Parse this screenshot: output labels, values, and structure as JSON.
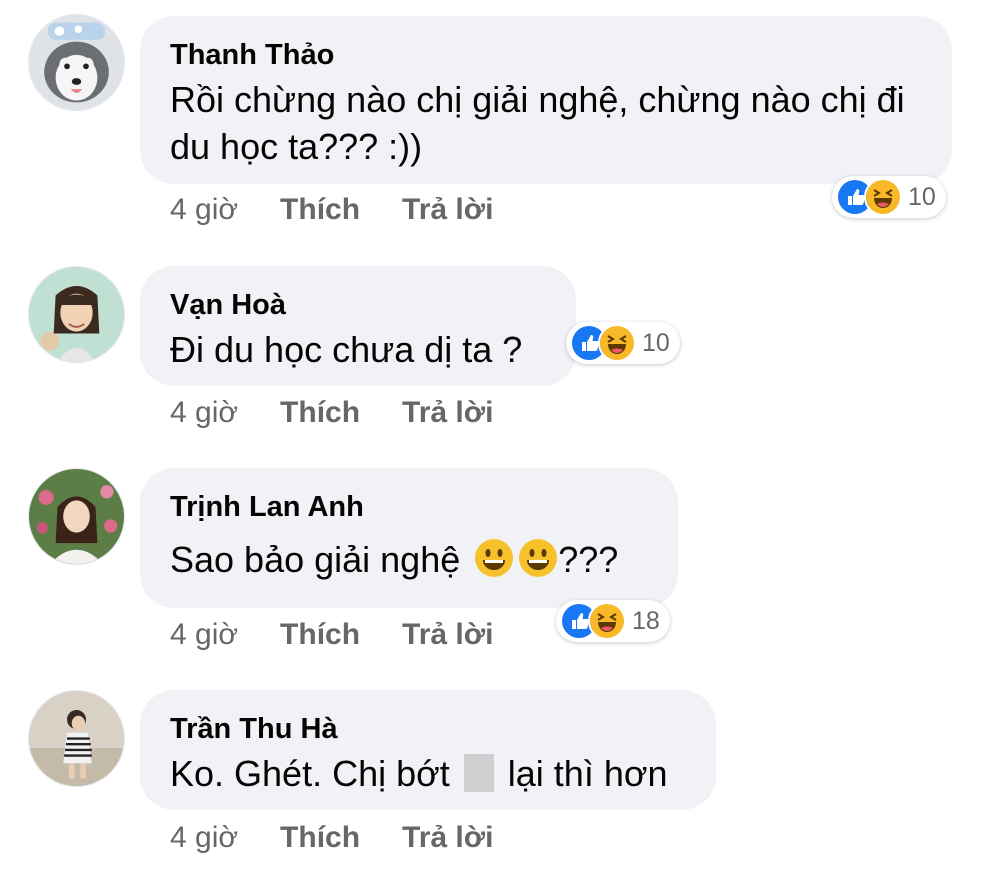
{
  "comments": [
    {
      "author": "Thanh Thảo",
      "text": "Rồi chừng nào chị giải nghệ, chừng nào chị đi du học ta??? :))",
      "time": "4 giờ",
      "like_label": "Thích",
      "reply_label": "Trả lời",
      "reaction_count": "10",
      "avatar": "husky-dog-avatar"
    },
    {
      "author": "Vạn Hoà",
      "text": "Đi du học chưa dị ta ?",
      "time": "4 giờ",
      "like_label": "Thích",
      "reply_label": "Trả lời",
      "reaction_count": "10",
      "avatar": "illustrated-girl-avatar"
    },
    {
      "author": "Trịnh Lan Anh",
      "text_before": "Sao bảo giải nghệ",
      "text_after": "???",
      "time": "4 giờ",
      "like_label": "Thích",
      "reply_label": "Trả lời",
      "reaction_count": "18",
      "avatar": "girl-with-flowers-avatar"
    },
    {
      "author": "Trần Thu Hà",
      "text_before": "Ko. Ghét. Chị bớt",
      "text_after": "lại thì hơn",
      "time": "4 giờ",
      "like_label": "Thích",
      "reply_label": "Trả lời",
      "avatar": "child-photo-avatar"
    }
  ],
  "colors": {
    "bubble": "#f0f2f5",
    "like_blue": "#1877f2",
    "haha_yellow": "#f7b928",
    "meta_gray": "#65676b"
  }
}
